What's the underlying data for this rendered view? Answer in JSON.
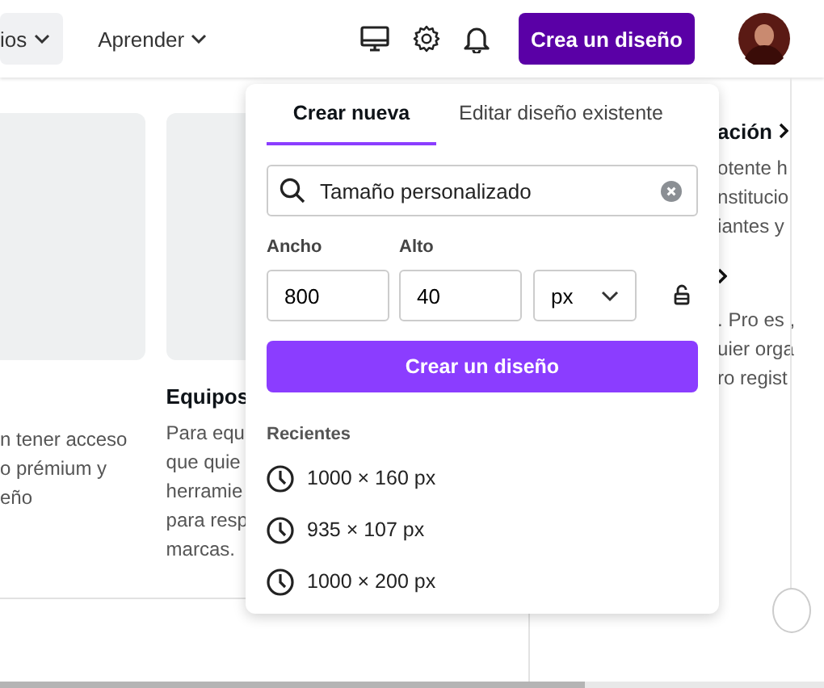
{
  "header": {
    "nav": [
      {
        "label": "ios",
        "selected": true
      },
      {
        "label": "Aprender",
        "selected": false
      }
    ],
    "create_button": "Crea un diseño"
  },
  "cards": [
    {
      "lines": [
        "n tener acceso",
        "o prémium y",
        "eño"
      ]
    },
    {
      "title": "Equipos",
      "lines": [
        "Para equ",
        "que quie",
        "herramie",
        "para resp",
        "marcas."
      ]
    }
  ],
  "side_panel": [
    {
      "title": "ación",
      "lines": [
        "otente h",
        "nstitucio",
        "iantes y"
      ]
    },
    {
      "lines": [
        ". Pro es ,",
        "uier orga",
        "ro regist"
      ]
    }
  ],
  "popup": {
    "tabs": [
      {
        "label": "Crear nueva",
        "selected": true
      },
      {
        "label": "Editar diseño existente",
        "selected": false
      }
    ],
    "search": {
      "value": "Tamaño personalizado"
    },
    "width": {
      "label": "Ancho",
      "value": "800"
    },
    "height": {
      "label": "Alto",
      "value": "40"
    },
    "unit": {
      "value": "px"
    },
    "create_button": "Crear un diseño",
    "recent": {
      "heading": "Recientes",
      "items": [
        "1000 × 160 px",
        "935 × 107 px",
        "1000 × 200 px"
      ]
    }
  }
}
